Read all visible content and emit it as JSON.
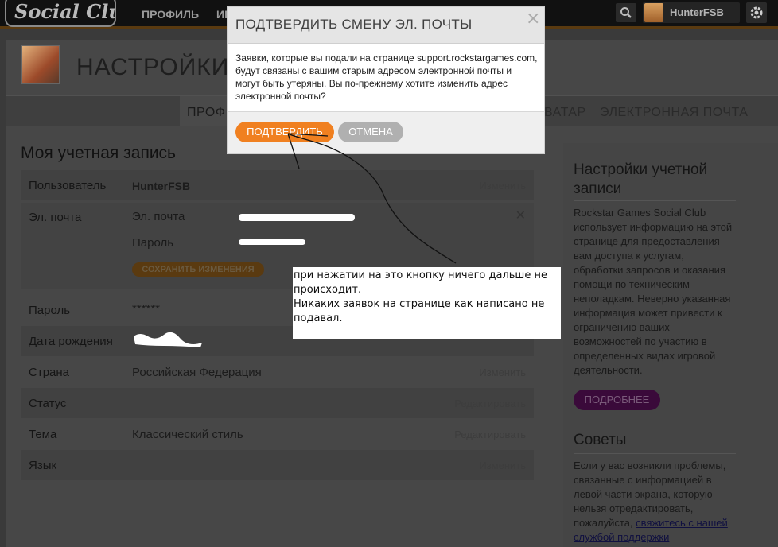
{
  "topbar": {
    "logo": "Social Club",
    "nav": [
      "ПРОФИЛЬ",
      "ИГ"
    ],
    "username": "HunterFSB"
  },
  "page": {
    "title": "НАСТРОЙКИ",
    "tabs": [
      "ПРОФ",
      "ВАТАР",
      "ЭЛЕКТРОННАЯ ПОЧТА"
    ]
  },
  "account": {
    "section_title": "Моя учетная запись",
    "rows": {
      "user": {
        "label": "Пользователь",
        "value": "HunterFSB",
        "action": "Изменить"
      },
      "email": {
        "label": "Эл. почта",
        "sub_email_label": "Эл. почта",
        "sub_password_label": "Пароль",
        "save_button": "СОХРАНИТЬ ИЗМЕНЕНИЯ"
      },
      "password": {
        "label": "Пароль",
        "value": "******"
      },
      "dob": {
        "label": "Дата рождения"
      },
      "country": {
        "label": "Страна",
        "value": "Российская Федерация",
        "action": "Изменить"
      },
      "status": {
        "label": "Статус",
        "action": "Редактировать"
      },
      "theme": {
        "label": "Тема",
        "value": "Классический стиль",
        "action": "Редактировать"
      },
      "language": {
        "label": "Язык",
        "action": "Изменить"
      }
    }
  },
  "sidebar": {
    "settings_title": "Настройки учетной записи",
    "settings_text": "Rockstar Games Social Club использует информацию на этой странице для предоставления вам доступа к услугам, обработки запросов и оказания помощи по техническим неполадкам. Неверно указанная информация может привести к ограничению ваших возможностей по участию в определенных видах игровой деятельности.",
    "more_button": "ПОДРОБНЕЕ",
    "tips_title": "Советы",
    "tips_text": "Если у вас возникли проблемы, связанные с информацией в левой части экрана, которую нельзя отредактировать, пожалуйста, ",
    "tips_link": "свяжитесь с нашей службой поддержки"
  },
  "modal": {
    "title": "ПОДТВЕРДИТЬ СМЕНУ ЭЛ. ПОЧТЫ",
    "body": "Заявки, которые вы подали на странице support.rockstargames.com, будут связаны с вашим старым адресом электронной почты и могут быть утеряны. Вы по-прежнему хотите изменить адрес электронной почты?",
    "confirm": "ПОДТВЕРДИТЬ",
    "cancel": "ОТМЕНА",
    "close": "×"
  },
  "annotation": {
    "text": "при нажатии на это кнопку ничего дальше не происходит.\nНикаких заявок на странице как написано не подавал."
  },
  "colors": {
    "accent": "#f08020",
    "overlay_bg": "#3a3a3a",
    "more_button": "#3a0a3a"
  }
}
